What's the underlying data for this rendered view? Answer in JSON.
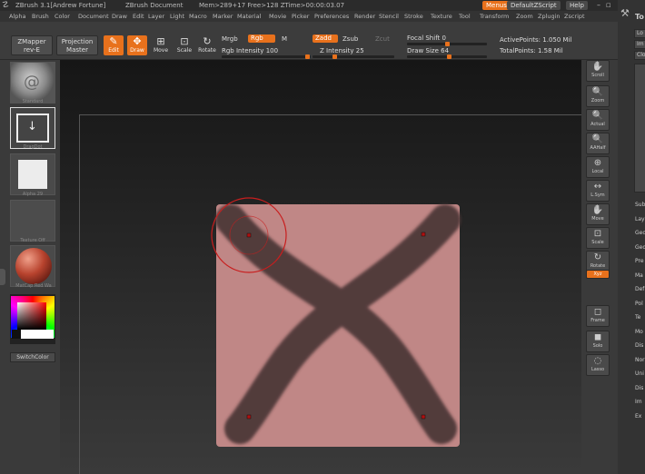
{
  "titlebar": {
    "app": "ZBrush 3.1[Andrew Fortune]",
    "document": "ZBrush Document",
    "stats": "Mem>289+17 Free>128 ZTime>00:00:03.07",
    "menus_button": "Menus",
    "script_button": "DefaultZScript",
    "help_button": "Help"
  },
  "menubar": [
    "Alpha",
    "Brush",
    "Color",
    "Document",
    "Draw",
    "Edit",
    "Layer",
    "Light",
    "Macro",
    "Marker",
    "Material",
    "Movie",
    "Picker",
    "Preferences",
    "Render",
    "Stencil",
    "Stroke",
    "Texture",
    "Tool",
    "Transform",
    "Zoom",
    "Zplugin",
    "Zscript"
  ],
  "toolbar": {
    "zmapper": "ZMapper",
    "zmapper_sub": "rev-E",
    "projection": "Projection",
    "projection_sub": "Master",
    "edit": "Edit",
    "draw": "Draw",
    "move": "Move",
    "scale": "Scale",
    "rotate": "Rotate",
    "mrgb": "Mrgb",
    "rgb": "Rgb",
    "m": "M",
    "rgb_intensity_label": "Rgb Intensity",
    "rgb_intensity": "100",
    "zadd": "Zadd",
    "zsub": "Zsub",
    "zcut": "Zcut",
    "z_intensity_label": "Z Intensity",
    "z_intensity": "25",
    "focal_shift_label": "Focal Shift",
    "focal_shift": "0",
    "draw_size_label": "Draw Size",
    "draw_size": "64",
    "active_points": "ActivePoints: 1.050 Mil",
    "total_points": "TotalPoints: 1.58 Mil"
  },
  "left": {
    "brush": "Standard",
    "stroke": "DragDot",
    "alpha": "Alpha 29",
    "texture": "Texture Off",
    "material": "MatCap Red Wa",
    "switch_color": "SwitchColor"
  },
  "shelf": [
    "Scroll",
    "Zoom",
    "Actual",
    "AAHalf",
    "Local",
    "L.Sym",
    "Move",
    "Scale",
    "Rotate",
    "Xyz",
    "",
    "",
    "Frame",
    "Solo",
    "Lasso"
  ],
  "toolpanel": {
    "title": "To",
    "buttons": [
      "Lo",
      "Im",
      "Clo"
    ],
    "items": [
      "Sub",
      "Lay",
      "Geo",
      "Geo",
      "Pre",
      "Ma",
      "Def",
      "Pol",
      "Te",
      "Mo",
      "Dis",
      "Nor",
      "Uni",
      "Dis",
      "Im",
      "Ex"
    ]
  },
  "colors": {
    "accent": "#e8711c",
    "canvas_fill": "#c08786",
    "stroke_color": "#4d3737"
  }
}
